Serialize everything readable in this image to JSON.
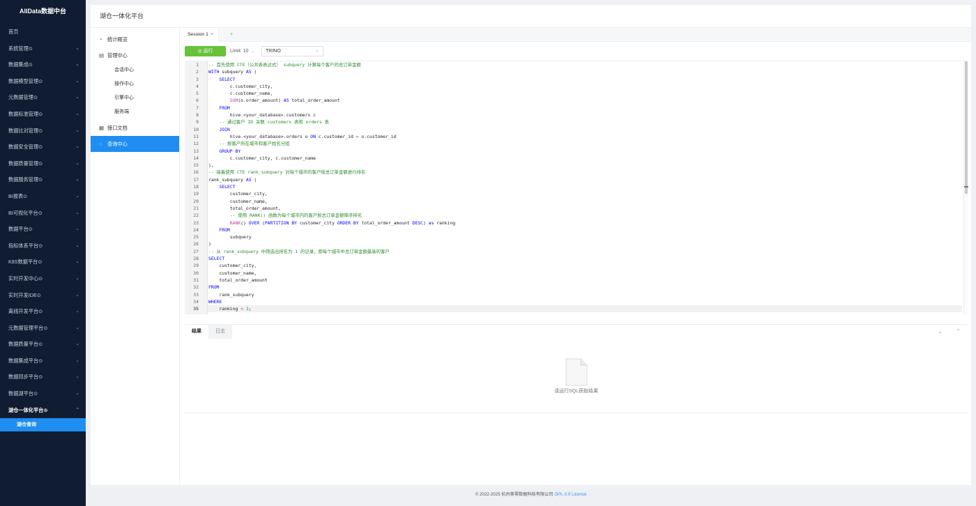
{
  "app": {
    "brand": "AllData数据中台"
  },
  "sidebar": {
    "items": [
      {
        "label": "首页",
        "arrow": ""
      },
      {
        "label": "系统管理⊙",
        "arrow": "⌄"
      },
      {
        "label": "数据集成⊙",
        "arrow": "⌄"
      },
      {
        "label": "数据模型管理⊙",
        "arrow": "⌄"
      },
      {
        "label": "元数据管理⊙",
        "arrow": "⌄"
      },
      {
        "label": "数据标准管理⊙",
        "arrow": "⌄"
      },
      {
        "label": "数据比对管理⊙",
        "arrow": "⌄"
      },
      {
        "label": "数据安全管理⊙",
        "arrow": "⌄"
      },
      {
        "label": "数据质量管理⊙",
        "arrow": "⌄"
      },
      {
        "label": "数据服务管理⊙",
        "arrow": "⌄"
      },
      {
        "label": "BI报表⊙",
        "arrow": "⌄"
      },
      {
        "label": "BI可视化平台⊙",
        "arrow": "⌄"
      },
      {
        "label": "数据平台⊙",
        "arrow": "⌄"
      },
      {
        "label": "指标体系平台⊙",
        "arrow": "⌄"
      },
      {
        "label": "K8S数据平台⊙",
        "arrow": "⌄"
      },
      {
        "label": "实时开发中心⊙",
        "arrow": "⌄"
      },
      {
        "label": "实时开发IDE⊙",
        "arrow": "⌄"
      },
      {
        "label": "离线开发平台⊙",
        "arrow": "⌄"
      },
      {
        "label": "元数据管理平台⊙",
        "arrow": "⌄"
      },
      {
        "label": "数据质量平台⊙",
        "arrow": "⌄"
      },
      {
        "label": "数据集成平台⊙",
        "arrow": "⌄"
      },
      {
        "label": "数据同步平台⊙",
        "arrow": "⌄"
      },
      {
        "label": "数据湖平台⊙",
        "arrow": "⌄"
      },
      {
        "label": "湖仓一体化平台⊙",
        "arrow": "⌃"
      }
    ],
    "active_sub": "湖仓查询"
  },
  "page": {
    "title": "湖仓一体化平台"
  },
  "leftmenu": {
    "stats": "统计概览",
    "manage": "管理中心",
    "subs": [
      "会话中心",
      "操作中心",
      "引擎中心",
      "服务端"
    ],
    "api_docs": "接口文档",
    "query_center": "查询中心"
  },
  "tabs": {
    "session": "Session 1",
    "close": "×",
    "add": "+"
  },
  "toolbar": {
    "run": "运行",
    "limit": "Limit: 10",
    "engine": "TRINO"
  },
  "editor": {
    "current_line": 35,
    "lines": [
      "-- 首先使用 CTE（公共表表达式） subquery 计算每个客户的总订单金额",
      "WITH subquery AS (",
      "    SELECT",
      "        c.customer_city,",
      "        c.customer_name,",
      "        SUM(o.order_amount) AS total_order_amount",
      "    FROM",
      "        hive.<your_database>.customers c",
      "    -- 通过客户 ID 关联 customers 表和 orders 表",
      "    JOIN",
      "        hive.<your_database>.orders o ON c.customer_id = o.customer_id",
      "    -- 按客户所在城市和客户姓名分组",
      "    GROUP BY",
      "        c.customer_city, c.customer_name",
      "),",
      "-- 接着使用 CTE rank_subquery 对每个城市的客户按总订单金额进行排名",
      "rank_subquery AS (",
      "    SELECT",
      "        customer_city,",
      "        customer_name,",
      "        total_order_amount,",
      "        -- 使用 RANK() 函数为每个城市内的客户按总订单金额降序排名",
      "        RANK() OVER (PARTITION BY customer_city ORDER BY total_order_amount DESC) as ranking",
      "    FROM",
      "        subquery",
      ")",
      "-- 从 rank_subquery 中筛选出排名为 1 的记录，即每个城市中总订单金额最高的客户",
      "SELECT",
      "    customer_city,",
      "    customer_name,",
      "    total_order_amount",
      "FROM",
      "    rank_subquery",
      "WHERE",
      "    ranking = 1;"
    ]
  },
  "results": {
    "tab_result": "结果",
    "tab_log": "日志",
    "collapse": "⌄",
    "expand": "⌃",
    "empty_message": "请运行SQL获取结果"
  },
  "footer": {
    "copyright": "© 2022-2025 杭州奥零数据科技有限公司",
    "license": "GPL-3.0 License"
  }
}
